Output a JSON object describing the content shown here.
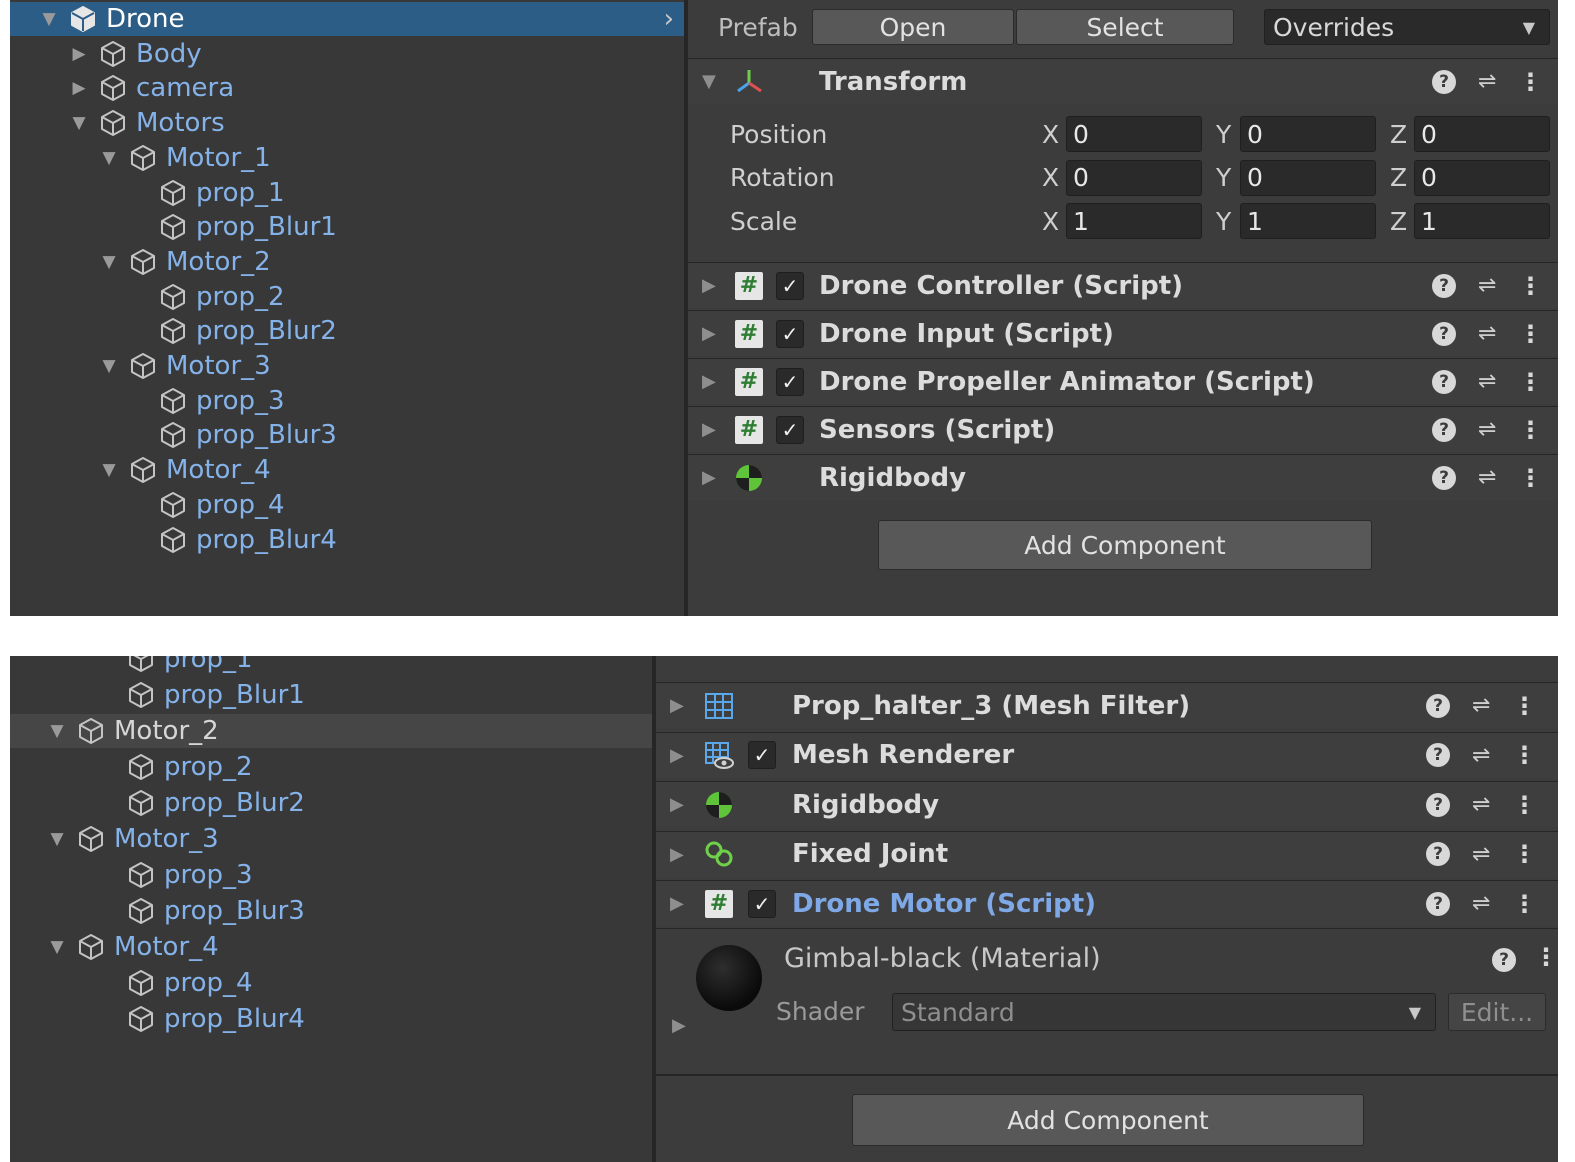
{
  "top": {
    "hierarchy": [
      {
        "label": "Drone",
        "depth": 0,
        "expanded": true,
        "selected": true
      },
      {
        "label": "Body",
        "depth": 1,
        "expanded": false,
        "hasChildren": true
      },
      {
        "label": "camera",
        "depth": 1,
        "expanded": false,
        "hasChildren": true
      },
      {
        "label": "Motors",
        "depth": 1,
        "expanded": true,
        "hasChildren": true
      },
      {
        "label": "Motor_1",
        "depth": 2,
        "expanded": true,
        "hasChildren": true
      },
      {
        "label": "prop_1",
        "depth": 3
      },
      {
        "label": "prop_Blur1",
        "depth": 3
      },
      {
        "label": "Motor_2",
        "depth": 2,
        "expanded": true,
        "hasChildren": true
      },
      {
        "label": "prop_2",
        "depth": 3
      },
      {
        "label": "prop_Blur2",
        "depth": 3
      },
      {
        "label": "Motor_3",
        "depth": 2,
        "expanded": true,
        "hasChildren": true
      },
      {
        "label": "prop_3",
        "depth": 3
      },
      {
        "label": "prop_Blur3",
        "depth": 3
      },
      {
        "label": "Motor_4",
        "depth": 2,
        "expanded": true,
        "hasChildren": true
      },
      {
        "label": "prop_4",
        "depth": 3
      },
      {
        "label": "prop_Blur4",
        "depth": 3
      }
    ],
    "prefab": {
      "label": "Prefab",
      "open": "Open",
      "select": "Select",
      "overrides": "Overrides"
    },
    "transform": {
      "title": "Transform",
      "rows": [
        {
          "label": "Position",
          "x": "0",
          "y": "0",
          "z": "0"
        },
        {
          "label": "Rotation",
          "x": "0",
          "y": "0",
          "z": "0"
        },
        {
          "label": "Scale",
          "x": "1",
          "y": "1",
          "z": "1"
        }
      ],
      "axes": {
        "x": "X",
        "y": "Y",
        "z": "Z"
      }
    },
    "components": [
      {
        "title": "Drone Controller (Script)",
        "icon": "script-icon",
        "checkbox": true
      },
      {
        "title": "Drone Input (Script)",
        "icon": "script-icon",
        "checkbox": true
      },
      {
        "title": "Drone Propeller Animator (Script)",
        "icon": "script-icon",
        "checkbox": true
      },
      {
        "title": "Sensors (Script)",
        "icon": "script-icon",
        "checkbox": true
      },
      {
        "title": "Rigidbody",
        "icon": "rigidbody-icon",
        "checkbox": false
      }
    ],
    "add_component": "Add Component"
  },
  "bottom": {
    "hierarchy": [
      {
        "label": "prop_1",
        "depth": 1,
        "partial": true
      },
      {
        "label": "prop_Blur1",
        "depth": 1
      },
      {
        "label": "Motor_2",
        "depth": 0,
        "expanded": true,
        "hasChildren": true,
        "highlight": true
      },
      {
        "label": "prop_2",
        "depth": 1
      },
      {
        "label": "prop_Blur2",
        "depth": 1
      },
      {
        "label": "Motor_3",
        "depth": 0,
        "expanded": true,
        "hasChildren": true
      },
      {
        "label": "prop_3",
        "depth": 1
      },
      {
        "label": "prop_Blur3",
        "depth": 1
      },
      {
        "label": "Motor_4",
        "depth": 0,
        "expanded": true,
        "hasChildren": true
      },
      {
        "label": "prop_4",
        "depth": 1
      },
      {
        "label": "prop_Blur4",
        "depth": 1
      }
    ],
    "components": [
      {
        "title": "Prop_halter_3 (Mesh Filter)",
        "icon": "mesh-filter-icon",
        "checkbox": false
      },
      {
        "title": "Mesh Renderer",
        "icon": "mesh-renderer-icon",
        "checkbox": true
      },
      {
        "title": "Rigidbody",
        "icon": "rigidbody-icon",
        "checkbox": false
      },
      {
        "title": "Fixed Joint",
        "icon": "fixed-joint-icon",
        "checkbox": false
      },
      {
        "title": "Drone Motor (Script)",
        "icon": "script-icon",
        "checkbox": true,
        "link": true
      }
    ],
    "material": {
      "title": "Gimbal-black (Material)",
      "shader_label": "Shader",
      "shader_value": "Standard",
      "edit": "Edit..."
    },
    "add_component": "Add Component"
  },
  "colors": {
    "selection": "#2c5d87",
    "link": "#85b2e8",
    "panel": "#383838"
  }
}
